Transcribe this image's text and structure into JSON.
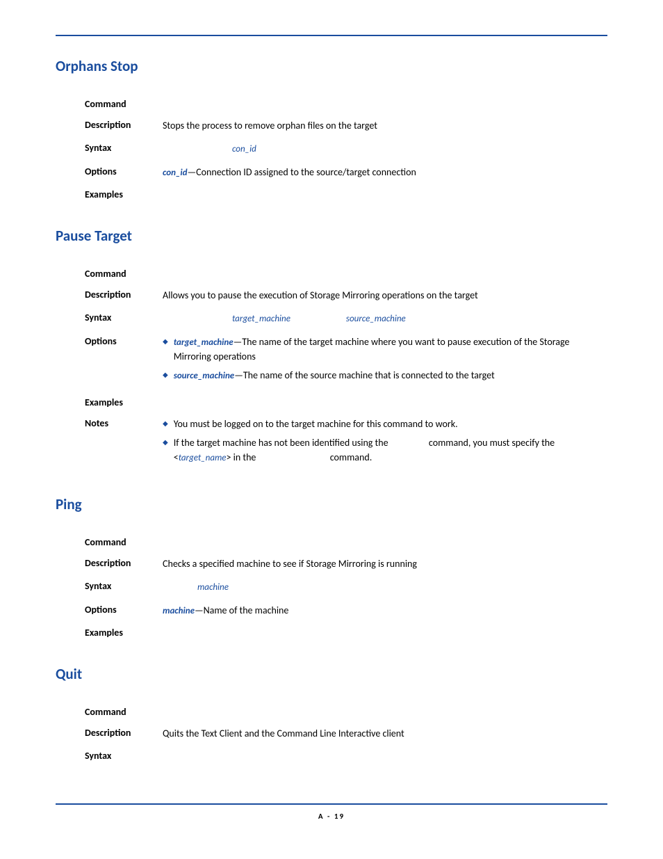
{
  "footer": "A - 19",
  "sections": {
    "orphans_stop": {
      "title": "Orphans Stop",
      "rows": {
        "command_label": "Command",
        "description_label": "Description",
        "description_text": "Stops the process to remove orphan files on the target",
        "syntax_label": "Syntax",
        "syntax_param": "con_id",
        "options_label": "Options",
        "options_kw": "con_id",
        "options_text": "—Connection ID assigned to the source/target connection",
        "examples_label": "Examples"
      }
    },
    "pause_target": {
      "title": "Pause Target",
      "rows": {
        "command_label": "Command",
        "description_label": "Description",
        "description_text": "Allows you to pause the execution of Storage Mirroring operations on the target",
        "syntax_label": "Syntax",
        "syntax_p1": "target_machine",
        "syntax_p2": "source_machine",
        "options_label": "Options",
        "opt1_kw": "target_machine",
        "opt1_text": "—The name of the target machine where you want to pause execution of the Storage Mirroring operations",
        "opt2_kw": "source_machine",
        "opt2_text": "—The name of the source machine that is connected to the target",
        "examples_label": "Examples",
        "notes_label": "Notes",
        "note1": "You must be logged on to the target machine for this command to work.",
        "note2_a": "If the target machine has not been identified using the ",
        "note2_b": " command, you must specify the <",
        "note2_param": "target_name",
        "note2_c": "> in the ",
        "note2_d": " command."
      }
    },
    "ping": {
      "title": "Ping",
      "rows": {
        "command_label": "Command",
        "description_label": "Description",
        "description_text": "Checks a specified machine to see if Storage Mirroring is running",
        "syntax_label": "Syntax",
        "syntax_param": "machine",
        "options_label": "Options",
        "options_kw": "machine",
        "options_text": "—Name of the machine",
        "examples_label": "Examples"
      }
    },
    "quit": {
      "title": "Quit",
      "rows": {
        "command_label": "Command",
        "description_label": "Description",
        "description_text": "Quits the Text Client and the Command Line Interactive client",
        "syntax_label": "Syntax"
      }
    }
  }
}
